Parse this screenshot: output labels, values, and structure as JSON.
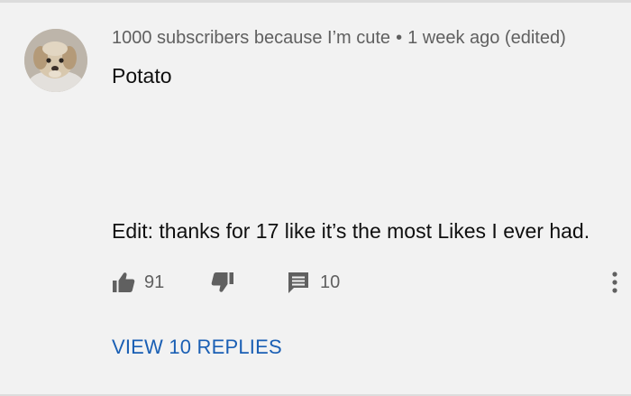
{
  "comment": {
    "author": "1000 subscribers because I’m cute",
    "separator": "•",
    "time": "1 week ago (edited)",
    "avatar_icon": "puppy-avatar",
    "text_line1": "Potato",
    "text_line2": "Edit: thanks for 17 like it’s the most Likes I ever had.",
    "likes": "91",
    "replies_count": "10",
    "view_replies": "VIEW 10 REPLIES"
  },
  "icons": {
    "like": "thumbs-up-icon",
    "dislike": "thumbs-down-icon",
    "reply": "comment-icon",
    "more": "more-vertical-icon"
  },
  "colors": {
    "background": "#f2f2f2",
    "meta_text": "#606060",
    "body_text": "#0f0f0f",
    "link": "#1a5fb4"
  }
}
